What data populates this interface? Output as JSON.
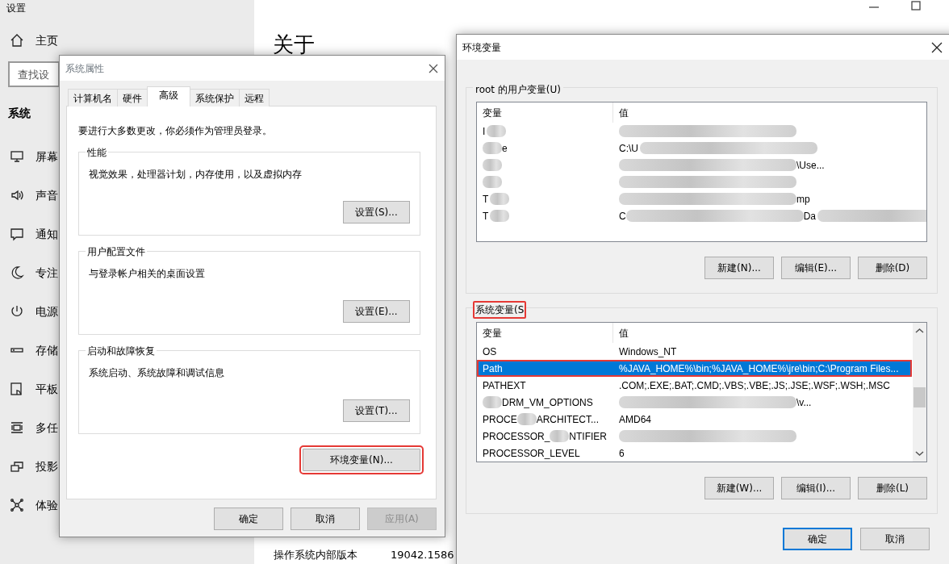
{
  "settings_window": {
    "title": "设置",
    "home": "主页",
    "search": {
      "placeholder": "查找设"
    },
    "section": "系统",
    "nav_items": [
      {
        "label": "屏幕"
      },
      {
        "label": "声音"
      },
      {
        "label": "通知"
      },
      {
        "label": "专注"
      },
      {
        "label": "电源"
      },
      {
        "label": "存储"
      },
      {
        "label": "平板"
      },
      {
        "label": "多任"
      },
      {
        "label": "投影"
      },
      {
        "label": "体验"
      }
    ],
    "page_title": "关于",
    "info_rows": [
      {
        "label": "操作系统内部版本",
        "value": "19042.1586"
      }
    ]
  },
  "system_properties": {
    "title": "系统属性",
    "tabs": [
      {
        "label": "计算机名",
        "selected": false
      },
      {
        "label": "硬件",
        "selected": false
      },
      {
        "label": "高级",
        "selected": true
      },
      {
        "label": "系统保护",
        "selected": false
      },
      {
        "label": "远程",
        "selected": false
      }
    ],
    "notice": "要进行大多数更改，你必须作为管理员登录。",
    "groups": [
      {
        "title": "性能",
        "description": "视觉效果，处理器计划，内存使用，以及虚拟内存",
        "button": "设置(S)..."
      },
      {
        "title": "用户配置文件",
        "description": "与登录帐户相关的桌面设置",
        "button": "设置(E)..."
      },
      {
        "title": "启动和故障恢复",
        "description": "系统启动、系统故障和调试信息",
        "button": "设置(T)..."
      }
    ],
    "env_button": {
      "label": "环境变量(N)...",
      "highlighted": true
    },
    "buttons": [
      {
        "label": "确定",
        "disabled": false
      },
      {
        "label": "取消",
        "disabled": false
      },
      {
        "label": "应用(A)",
        "disabled": true
      }
    ]
  },
  "environment_variables": {
    "title": "环境变量",
    "user_group": {
      "label": "root 的用户变量(U)",
      "highlighted": false,
      "columns": [
        "变量",
        "值"
      ],
      "rows": [
        {
          "name": [
            "I",
            {
              "kind": "blur"
            }
          ],
          "value": [
            {
              "kind": "blur"
            }
          ],
          "selected": false,
          "highlighted": false
        },
        {
          "name": [
            {
              "kind": "blur"
            },
            "e"
          ],
          "value": [
            "C:\\U",
            {
              "kind": "blur"
            }
          ],
          "selected": false,
          "highlighted": false
        },
        {
          "name": [
            {
              "kind": "blur"
            }
          ],
          "value": [
            {
              "kind": "blur"
            },
            "\\Use..."
          ],
          "selected": false,
          "highlighted": false
        },
        {
          "name": [
            {
              "kind": "blur"
            }
          ],
          "value": [
            {
              "kind": "blur"
            }
          ],
          "selected": false,
          "highlighted": false
        },
        {
          "name": [
            "T",
            {
              "kind": "blur"
            }
          ],
          "value": [
            {
              "kind": "blur"
            },
            "mp"
          ],
          "selected": false,
          "highlighted": false
        },
        {
          "name": [
            "T",
            {
              "kind": "blur"
            }
          ],
          "value": [
            "C",
            {
              "kind": "blur"
            },
            "Da",
            {
              "kind": "blur"
            }
          ],
          "selected": false,
          "highlighted": false
        }
      ],
      "buttons": [
        "新建(N)...",
        "编辑(E)...",
        "删除(D)"
      ]
    },
    "system_group": {
      "label": "系统变量(S",
      "highlighted": true,
      "columns": [
        "变量",
        "值"
      ],
      "rows": [
        {
          "name": [
            "OS"
          ],
          "value": [
            "Windows_NT"
          ],
          "selected": false,
          "highlighted": false
        },
        {
          "name": [
            "Path"
          ],
          "value": [
            "%JAVA_HOME%\\bin;%JAVA_HOME%\\jre\\bin;C:\\Program Files..."
          ],
          "selected": true,
          "highlighted": true
        },
        {
          "name": [
            "PATHEXT"
          ],
          "value": [
            ".COM;.EXE;.BAT;.CMD;.VBS;.VBE;.JS;.JSE;.WSF;.WSH;.MSC"
          ],
          "selected": false,
          "highlighted": false
        },
        {
          "name": [
            {
              "kind": "blur"
            },
            "DRM_VM_OPTIONS"
          ],
          "value": [
            {
              "kind": "blur"
            },
            "\\v..."
          ],
          "selected": false,
          "highlighted": false
        },
        {
          "name": [
            "PROCE",
            {
              "kind": "blur"
            },
            "ARCHITECT..."
          ],
          "value": [
            "AMD64"
          ],
          "selected": false,
          "highlighted": false
        },
        {
          "name": [
            "PROCESSOR_",
            {
              "kind": "blur"
            },
            "NTIFIER"
          ],
          "value": [
            {
              "kind": "blur"
            }
          ],
          "selected": false,
          "highlighted": false
        },
        {
          "name": [
            "PROCESSOR_LEVEL"
          ],
          "value": [
            "6"
          ],
          "selected": false,
          "highlighted": false
        }
      ],
      "buttons": [
        "新建(W)...",
        "编辑(I)...",
        "删除(L)"
      ]
    },
    "buttons": [
      {
        "label": "确定",
        "default": true
      },
      {
        "label": "取消",
        "default": false
      }
    ]
  }
}
